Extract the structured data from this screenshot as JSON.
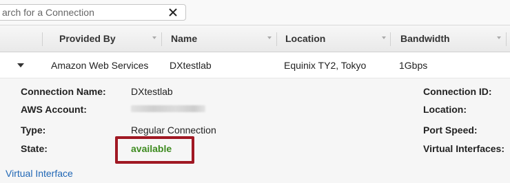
{
  "search": {
    "placeholder": "arch for a Connection"
  },
  "table": {
    "columns": [
      "Provided By",
      "Name",
      "Location",
      "Bandwidth"
    ],
    "row": {
      "provided_by": "Amazon Web Services",
      "name": "DXtestlab",
      "location": "Equinix TY2, Tokyo",
      "bandwidth": "1Gbps"
    }
  },
  "details": {
    "left": [
      {
        "label": "Connection Name:",
        "value": "DXtestlab"
      },
      {
        "label": "AWS Account:",
        "value": ""
      },
      {
        "label": "Type:",
        "value": "Regular Connection"
      },
      {
        "label": "State:",
        "value": "available"
      }
    ],
    "right": [
      {
        "label": "Connection ID:"
      },
      {
        "label": "Location:"
      },
      {
        "label": "Port Speed:"
      },
      {
        "label": "Virtual Interfaces:"
      }
    ],
    "link": "Virtual Interface"
  },
  "colors": {
    "state_available": "#3d8b1f",
    "highlight": "#a01823",
    "link": "#1f66b5"
  }
}
